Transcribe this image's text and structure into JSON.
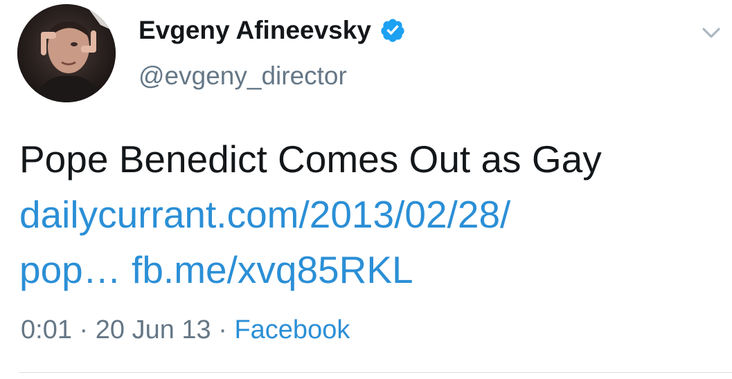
{
  "tweet": {
    "author": {
      "display_name": "Evgeny Afineevsky",
      "handle": "@evgeny_director",
      "verified": true,
      "avatar_icon": "user-avatar-photo"
    },
    "text": "Pope Benedict Comes Out as Gay",
    "links": [
      {
        "text": "dailycurrant.com/2013/02/28/"
      },
      {
        "text": "pop…"
      },
      {
        "text": "fb.me/xvq85RKL"
      }
    ],
    "meta": {
      "time": "0:01",
      "separator": "·",
      "date": "20 Jun 13",
      "source": "Facebook"
    },
    "menu_icon": "chevron-down-icon"
  },
  "colors": {
    "text": "#14171a",
    "secondary": "#657786",
    "link": "#2b8fd6",
    "verified": "#1da1f2",
    "divider": "#d9dee2"
  }
}
